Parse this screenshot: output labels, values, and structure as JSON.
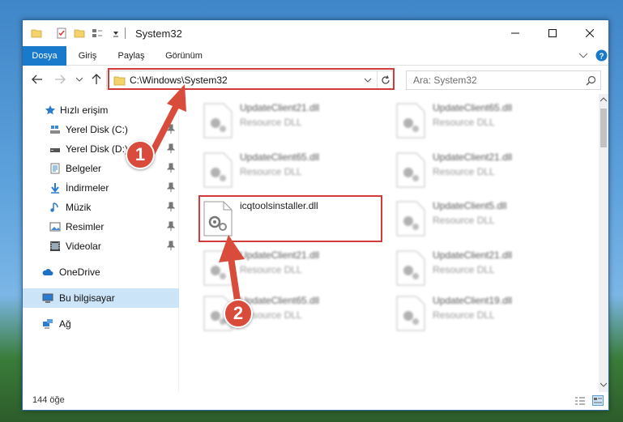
{
  "window": {
    "title": "System32"
  },
  "ribbon": {
    "tabs": [
      "Dosya",
      "Giriş",
      "Paylaş",
      "Görünüm"
    ],
    "active_tab": "Dosya"
  },
  "address": {
    "path": "C:\\Windows\\System32"
  },
  "search": {
    "placeholder": "Ara: System32"
  },
  "sidebar": {
    "items": [
      {
        "label": "Hızlı erişim",
        "icon": "star-icon"
      },
      {
        "label": "Yerel Disk (C:)",
        "icon": "drive-icon",
        "pinned": true
      },
      {
        "label": "Yerel Disk (D:)",
        "icon": "drive-icon",
        "pinned": true
      },
      {
        "label": "Belgeler",
        "icon": "documents-icon",
        "pinned": true
      },
      {
        "label": "İndirmeler",
        "icon": "download-icon",
        "pinned": true
      },
      {
        "label": "Müzik",
        "icon": "music-icon",
        "pinned": true
      },
      {
        "label": "Resimler",
        "icon": "pictures-icon",
        "pinned": true
      },
      {
        "label": "Videolar",
        "icon": "video-icon",
        "pinned": true
      },
      {
        "label": "OneDrive",
        "icon": "cloud-icon"
      },
      {
        "label": "Bu bilgisayar",
        "icon": "computer-icon",
        "selected": true
      },
      {
        "label": "Ağ",
        "icon": "network-icon"
      }
    ]
  },
  "files": [
    {
      "name": "UpdateClient21.dll",
      "desc": "Resource DLL"
    },
    {
      "name": "UpdateClient65.dll",
      "desc": "Resource DLL"
    },
    {
      "name": "UpdateClient65.dll",
      "desc": "Resource DLL"
    },
    {
      "name": "UpdateClient21.dll",
      "desc": "Resource DLL"
    },
    {
      "name": "icqtoolsinstaller.dll",
      "desc": ""
    },
    {
      "name": "UpdateClient5.dll",
      "desc": "Resource DLL"
    },
    {
      "name": "UpdateClient21.dll",
      "desc": "Resource DLL"
    },
    {
      "name": "UpdateClient21.dll",
      "desc": "Resource DLL"
    },
    {
      "name": "UpdateClient65.dll",
      "desc": "Resource DLL"
    },
    {
      "name": "UpdateClient19.dll",
      "desc": "Resource DLL"
    }
  ],
  "status": {
    "count": "144 öğe"
  },
  "annotations": {
    "step1": "1",
    "step2": "2"
  },
  "colors": {
    "accent": "#1979ca",
    "highlight": "#d53a3a",
    "badge": "#d94c3c"
  }
}
